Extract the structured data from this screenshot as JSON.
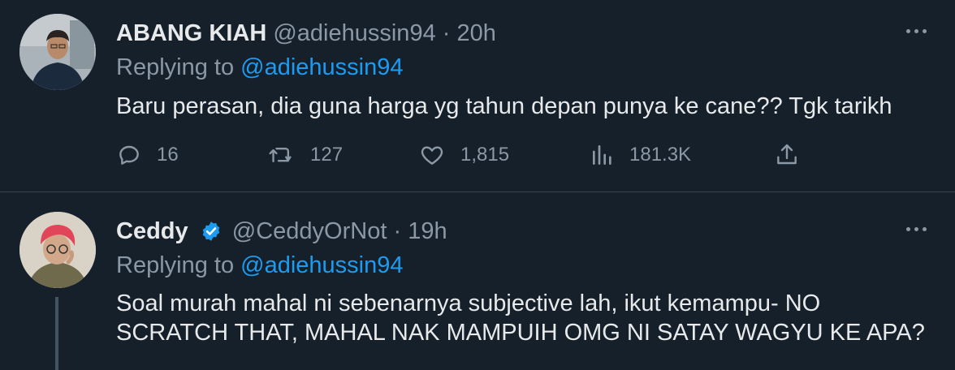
{
  "tweets": [
    {
      "name": "ABANG KIAH",
      "handle": "@adiehussin94",
      "separator": "·",
      "time": "20h",
      "replying_prefix": "Replying to",
      "replying_to": "@adiehussin94",
      "text": "Baru perasan, dia guna harga yg tahun depan punya ke cane?? Tgk tarikh",
      "stats": {
        "replies": "16",
        "retweets": "127",
        "likes": "1,815",
        "views": "181.3K"
      },
      "icons": [
        "reply-icon",
        "retweet-icon",
        "like-icon",
        "views-icon",
        "share-icon",
        "more-icon"
      ]
    },
    {
      "name": "Ceddy",
      "verified": true,
      "handle": "@CeddyOrNot",
      "separator": "·",
      "time": "19h",
      "replying_prefix": "Replying to",
      "replying_to": "@adiehussin94",
      "text": "Soal murah mahal ni sebenarnya subjective lah, ikut kemampu- NO SCRATCH THAT, MAHAL NAK MAMPUIH OMG NI SATAY WAGYU KE APA?",
      "icons": [
        "verified-badge-icon",
        "more-icon"
      ]
    }
  ],
  "colors": {
    "background": "#15202b",
    "text": "#e7e9ea",
    "muted": "#8b98a5",
    "link": "#1d9bf0",
    "divider": "#38444d"
  }
}
